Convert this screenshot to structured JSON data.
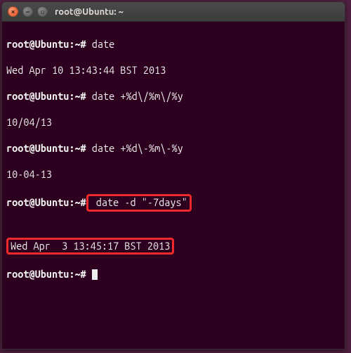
{
  "titlebar": {
    "title": "root@Ubuntu: ~",
    "close_symbol": "×",
    "minimize_symbol": "−",
    "maximize_symbol": "▫"
  },
  "terminal": {
    "lines": [
      {
        "prompt": "root@Ubuntu:~#",
        "cmd": " date"
      },
      {
        "output": "Wed Apr 10 13:43:44 BST 2013"
      },
      {
        "prompt": "root@Ubuntu:~#",
        "cmd": " date +%d\\/%m\\/%y"
      },
      {
        "output": "10/04/13"
      },
      {
        "prompt": "root@Ubuntu:~#",
        "cmd": " date +%d\\-%m\\-%y"
      },
      {
        "output": "10-04-13"
      },
      {
        "prompt": "root@Ubuntu:~#",
        "cmd_highlight": " date -d \"-7days\""
      },
      {
        "output": ""
      },
      {
        "output_highlight": "Wed Apr  3 13:45:17 BST 2013"
      },
      {
        "prompt": "root@Ubuntu:~#",
        "cursor": true
      }
    ]
  }
}
